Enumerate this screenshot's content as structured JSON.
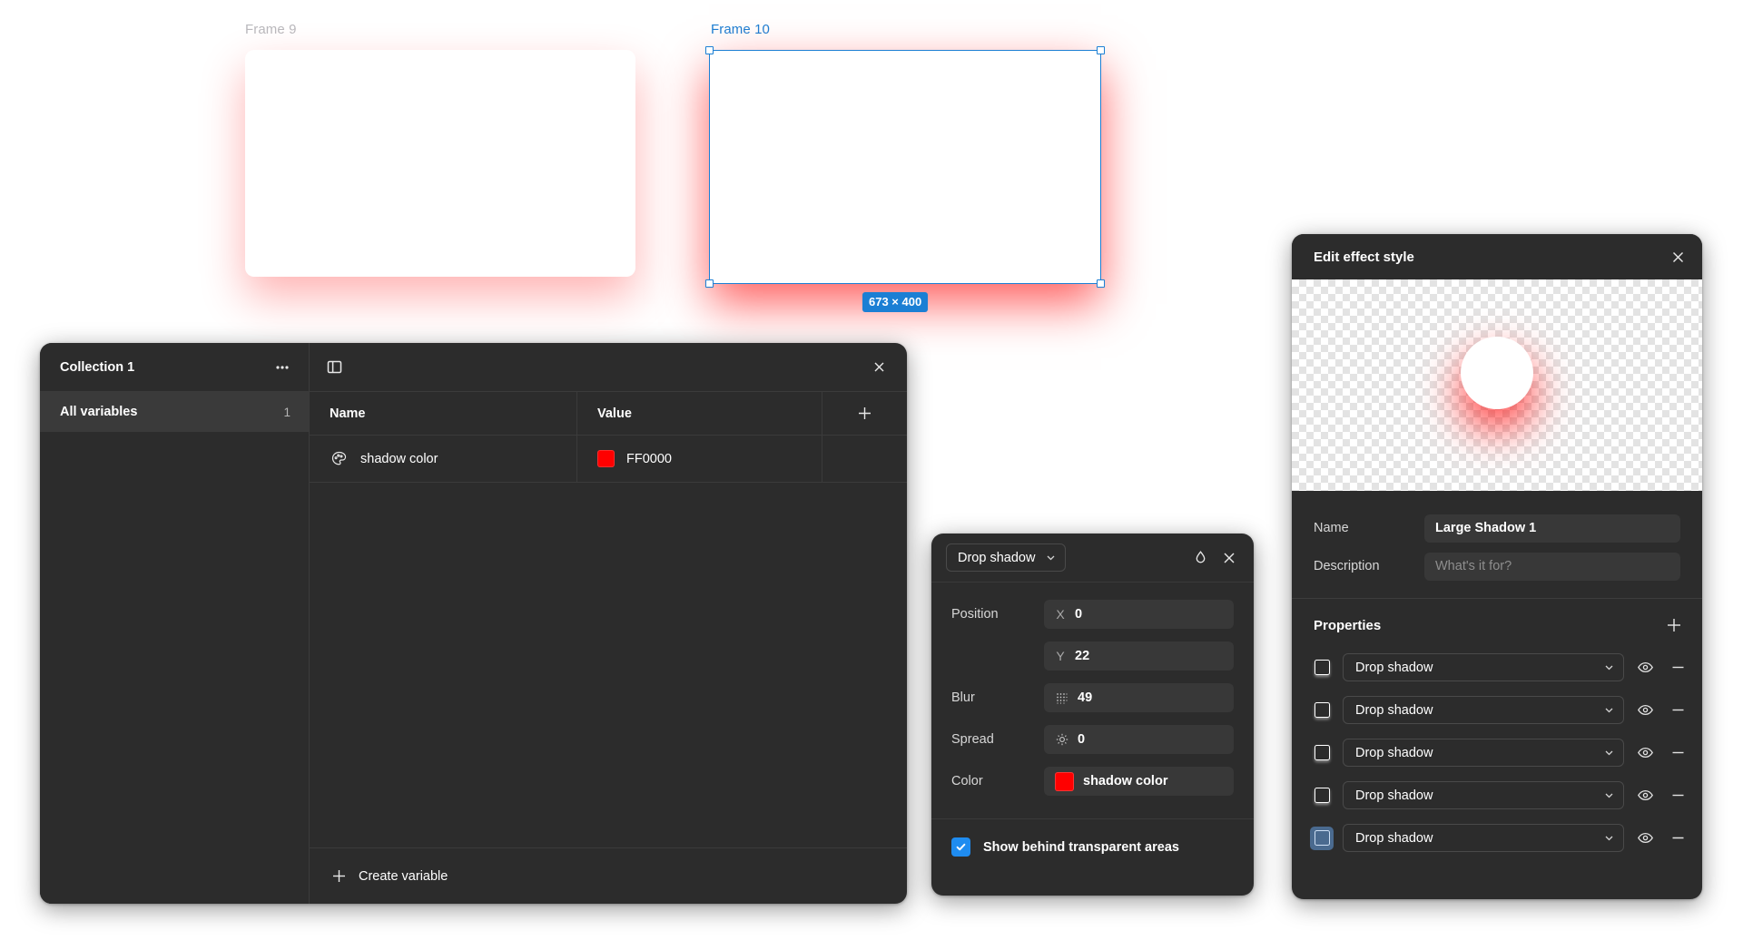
{
  "canvas": {
    "frames": [
      {
        "label": "Frame 9",
        "state": "unselected"
      },
      {
        "label": "Frame 10",
        "state": "selected"
      }
    ],
    "selection_size_badge": "673 × 400",
    "selection_color": "#1b7fd4",
    "shadow_color": "#FF0000"
  },
  "variables_panel": {
    "collection_title": "Collection 1",
    "more_icon": "ellipsis-icon",
    "sidebar_toggle_icon": "sidebar-toggle-icon",
    "close_icon": "close-icon",
    "collection_item": {
      "label": "All variables",
      "count": "1"
    },
    "columns": [
      "Name",
      "Value"
    ],
    "add_icon": "plus-icon",
    "rows": [
      {
        "type_icon": "color-palette-icon",
        "name": "shadow color",
        "swatch": "#FF0000",
        "value": "FF0000"
      }
    ],
    "footer": {
      "icon": "plus-icon",
      "label": "Create variable"
    }
  },
  "shadow_popover": {
    "type": "Drop shadow",
    "type_chevron_icon": "chevron-down-icon",
    "blend_icon": "droplet-icon",
    "close_icon": "close-icon",
    "fields": [
      {
        "label": "Position",
        "axis": "X",
        "value": "0"
      },
      {
        "label": "",
        "axis": "Y",
        "value": "22"
      },
      {
        "label": "Blur",
        "icon": "blur-grid-icon",
        "value": "49"
      },
      {
        "label": "Spread",
        "icon": "spread-radial-icon",
        "value": "0"
      }
    ],
    "color": {
      "label": "Color",
      "swatch": "#FF0000",
      "value": "shadow color"
    },
    "checkbox": {
      "label": "Show behind transparent areas",
      "checked": true,
      "icon": "check-icon"
    }
  },
  "effect_dialog": {
    "title": "Edit effect style",
    "close_icon": "close-icon",
    "preview_shadow_color": "#FF0000",
    "name_label": "Name",
    "name_value": "Large Shadow 1",
    "description_label": "Description",
    "description_placeholder": "What's it for?",
    "properties_title": "Properties",
    "add_icon": "plus-icon",
    "properties": [
      {
        "label": "Drop shadow",
        "chevron": "chevron-down-icon",
        "visibility_icon": "eye-icon",
        "remove_icon": "minus-icon",
        "selected": false
      },
      {
        "label": "Drop shadow",
        "chevron": "chevron-down-icon",
        "visibility_icon": "eye-icon",
        "remove_icon": "minus-icon",
        "selected": false
      },
      {
        "label": "Drop shadow",
        "chevron": "chevron-down-icon",
        "visibility_icon": "eye-icon",
        "remove_icon": "minus-icon",
        "selected": false
      },
      {
        "label": "Drop shadow",
        "chevron": "chevron-down-icon",
        "visibility_icon": "eye-icon",
        "remove_icon": "minus-icon",
        "selected": false
      },
      {
        "label": "Drop shadow",
        "chevron": "chevron-down-icon",
        "visibility_icon": "eye-icon",
        "remove_icon": "minus-icon",
        "selected": true
      }
    ]
  }
}
